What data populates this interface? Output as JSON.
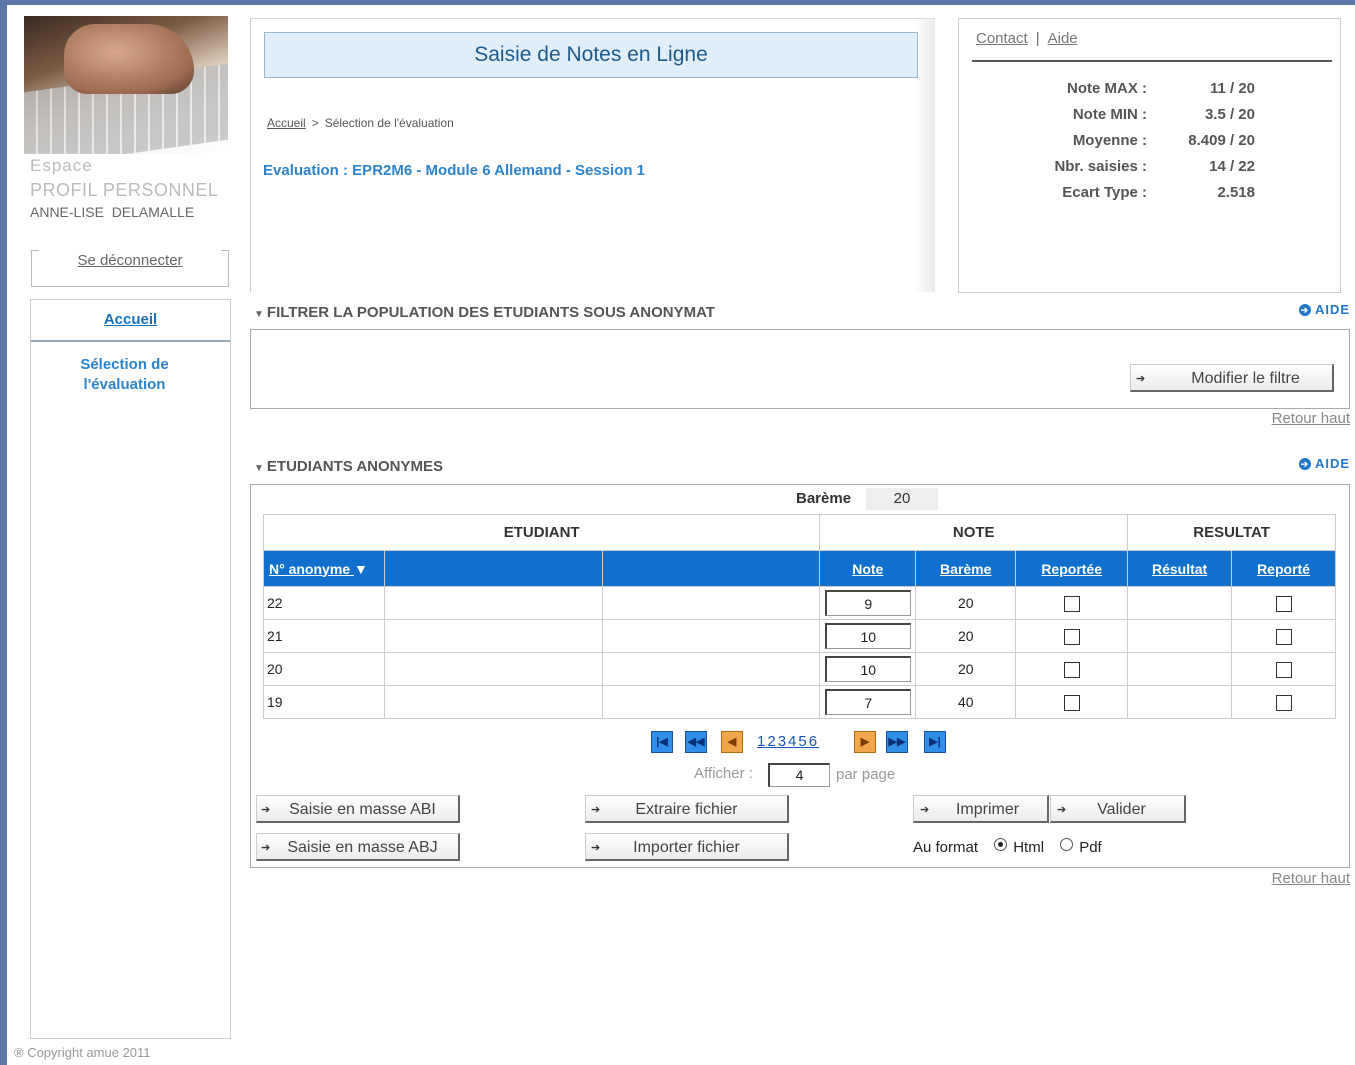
{
  "sidebar": {
    "espace": "Espace",
    "profil": "PROFIL PERSONNEL",
    "user": "ANNE-LISE  DELAMALLE",
    "logout": "Se déconnecter",
    "nav": {
      "accueil": "Accueil",
      "selection_line1": "Sélection de",
      "selection_line2": "l'évaluation"
    },
    "copyright": "® Copyright amue 2011"
  },
  "header": {
    "title": "Saisie de Notes en Ligne",
    "breadcrumb": {
      "home": "Accueil",
      "separator": ">",
      "current": "Sélection de l'évaluation"
    },
    "evaluation": "Evaluation : EPR2M6 - Module 6 Allemand - Session 1"
  },
  "toplinks": {
    "contact": "Contact",
    "separator": "|",
    "aide": "Aide"
  },
  "stats": [
    {
      "label": "Note MAX :",
      "value": "11 / 20"
    },
    {
      "label": "Note MIN :",
      "value": "3.5 / 20"
    },
    {
      "label": "Moyenne :",
      "value": "8.409 / 20"
    },
    {
      "label": "Nbr. saisies :",
      "value": "14 / 22"
    },
    {
      "label": "Ecart Type :",
      "value": "2.518"
    }
  ],
  "filter_section": {
    "title": "FILTRER LA POPULATION DES ETUDIANTS SOUS ANONYMAT",
    "aide": "AIDE",
    "button": "Modifier le filtre",
    "retour": "Retour haut"
  },
  "students_section": {
    "title": "ETUDIANTS ANONYMES",
    "aide": "AIDE",
    "bareme_label": "Barème",
    "bareme_value": "20",
    "groups": {
      "etudiant": "ETUDIANT",
      "note": "NOTE",
      "resultat": "RESULTAT"
    },
    "columns": {
      "anonyme": "N° anonyme",
      "note": "Note",
      "bareme": "Barème",
      "reportee": "Reportée",
      "resultat": "Résultat",
      "reporte": "Reporté"
    },
    "rows": [
      {
        "id": "22",
        "note": "9",
        "bareme": "20",
        "reportee": false,
        "resultat": "",
        "reporte": false
      },
      {
        "id": "21",
        "note": "10",
        "bareme": "20",
        "reportee": false,
        "resultat": "",
        "reporte": false
      },
      {
        "id": "20",
        "note": "10",
        "bareme": "20",
        "reportee": false,
        "resultat": "",
        "reporte": false
      },
      {
        "id": "19",
        "note": "7",
        "bareme": "40",
        "reportee": false,
        "resultat": "",
        "reporte": false
      }
    ],
    "pager": {
      "pages": [
        "1",
        "2",
        "3",
        "4",
        "5",
        "6"
      ],
      "afficher": "Afficher :",
      "per_page": "4",
      "par_page": "par page"
    },
    "buttons": {
      "saisie_abi": "Saisie en masse ABI",
      "saisie_abj": "Saisie en masse ABJ",
      "extraire": "Extraire fichier",
      "importer": "Importer fichier",
      "imprimer": "Imprimer",
      "valider": "Valider"
    },
    "format": {
      "label": "Au format",
      "html": "Html",
      "pdf": "Pdf",
      "selected": "Html"
    },
    "retour": "Retour haut"
  }
}
